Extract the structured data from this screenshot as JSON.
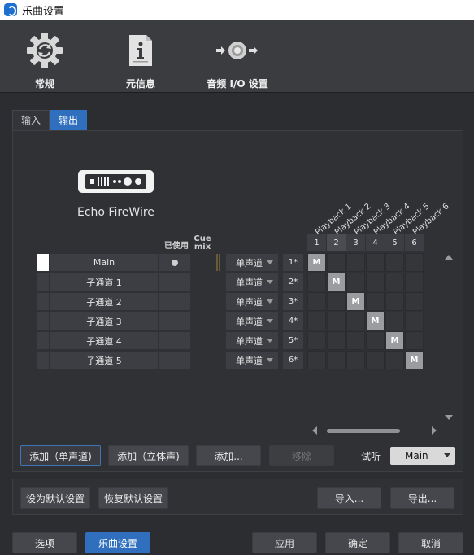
{
  "window": {
    "title": "乐曲设置"
  },
  "header": {
    "buttons": [
      {
        "label": "常规",
        "icon": "gear-icon"
      },
      {
        "label": "元信息",
        "icon": "info-document-icon"
      },
      {
        "label": "音频 I/O 设置",
        "icon": "audio-io-icon"
      }
    ]
  },
  "tabs": [
    "输入",
    "输出"
  ],
  "device": {
    "name": "Echo FireWire",
    "icon": "audio-interface-icon"
  },
  "columns": {
    "used": "已使用",
    "cue_mix": "Cue mix"
  },
  "channels": [
    {
      "name": "Main",
      "mode": "单声道",
      "num": "1*",
      "used": true
    },
    {
      "name": "子通道 1",
      "mode": "单声道",
      "num": "2*",
      "used": false
    },
    {
      "name": "子通道 2",
      "mode": "单声道",
      "num": "3*",
      "used": false
    },
    {
      "name": "子通道 3",
      "mode": "单声道",
      "num": "4*",
      "used": false
    },
    {
      "name": "子通道 4",
      "mode": "单声道",
      "num": "5*",
      "used": false
    },
    {
      "name": "子通道 5",
      "mode": "单声道",
      "num": "6*",
      "used": false
    }
  ],
  "playbacks": [
    "Playback 1",
    "Playback 2",
    "Playback 3",
    "Playback 4",
    "Playback 5",
    "Playback 6"
  ],
  "grid_headers": [
    "1",
    "2",
    "3",
    "4",
    "5",
    "6"
  ],
  "matrix_mark": "M",
  "buttons": {
    "add_mono": "添加（单声道)",
    "add_stereo": "添加（立体声)",
    "add_more": "添加...",
    "remove": "移除",
    "listen_label": "试听",
    "listen_value": "Main",
    "set_default": "设为默认设置",
    "restore_default": "恢复默认设置",
    "import": "导入...",
    "export": "导出...",
    "options": "选项",
    "song_settings": "乐曲设置",
    "apply": "应用",
    "ok": "确定",
    "cancel": "取消"
  },
  "colors": {
    "accent": "#2f6fbd",
    "panel": "#2f3135"
  }
}
